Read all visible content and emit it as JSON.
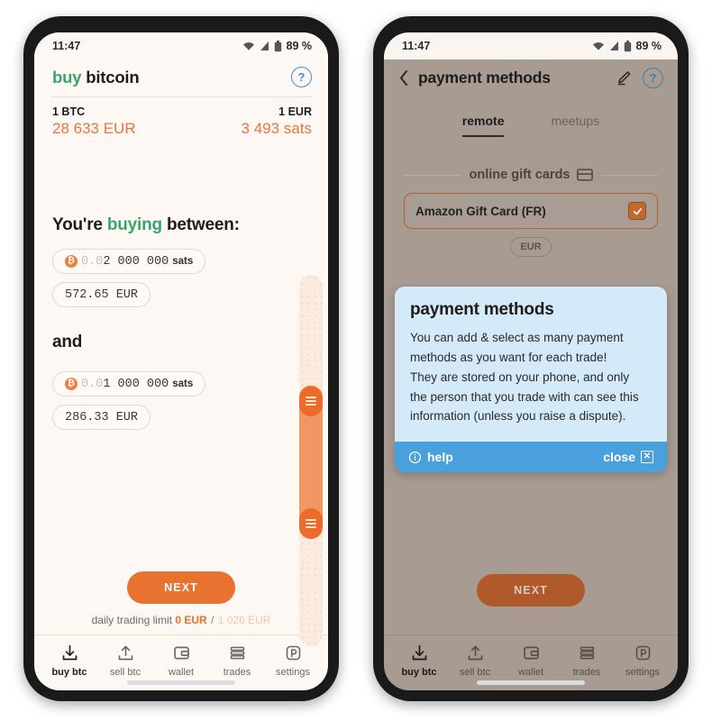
{
  "status_bar": {
    "time": "11:47",
    "battery": "89 %"
  },
  "left": {
    "header": {
      "title_accent": "buy",
      "title_rest": " bitcoin",
      "help_icon": "help-circle-icon"
    },
    "rates": {
      "left_label": "1 BTC",
      "left_value": "28 633 EUR",
      "right_label": "1 EUR",
      "right_value": "3 493 sats"
    },
    "section_one": {
      "prefix": "You're ",
      "accent": "buying",
      "suffix": " between:"
    },
    "section_two": {
      "label": "and"
    },
    "amount_max": {
      "btc_badge": "bitcoin-icon",
      "dim_prefix": "0.0",
      "value": "2 000 000",
      "unit": "sats",
      "fiat": "572.65 EUR"
    },
    "amount_min": {
      "btc_badge": "bitcoin-icon",
      "dim_prefix": "0.0",
      "value": "1 000 000",
      "unit": "sats",
      "fiat": "286.33 EUR"
    },
    "slider": {
      "name": "range-slider",
      "thumb_top_pct": 34,
      "thumb_bottom_pct": 67
    },
    "next_label": "NEXT",
    "limit": {
      "label": "daily trading limit",
      "used": "0 EUR",
      "slash": "/",
      "max": "1 026 EUR"
    }
  },
  "right": {
    "header": {
      "back_icon": "chevron-left-icon",
      "title": "payment methods",
      "edit_icon": "pencil-icon",
      "help_icon": "help-circle-icon"
    },
    "tabs": [
      {
        "label": "remote",
        "active": true
      },
      {
        "label": "meetups",
        "active": false
      }
    ],
    "section": {
      "title": "online gift cards",
      "icon": "card-icon"
    },
    "payment_method": {
      "label": "Amazon Gift Card (FR)",
      "checked": true
    },
    "currency_chip": "EUR",
    "next_label": "NEXT",
    "modal": {
      "title": "payment methods",
      "lines": [
        "You can add & select as many payment",
        "methods as you want for each trade!",
        "They are stored on your phone, and only",
        "the person that you trade with can see this",
        "information (unless you raise a dispute)."
      ],
      "help_label": "help",
      "close_label": "close"
    }
  },
  "nav": [
    {
      "label": "buy btc",
      "icon": "download-tray-icon",
      "active": true
    },
    {
      "label": "sell btc",
      "icon": "upload-tray-icon",
      "active": false
    },
    {
      "label": "wallet",
      "icon": "wallet-icon",
      "active": false
    },
    {
      "label": "trades",
      "icon": "stacked-bars-icon",
      "active": false
    },
    {
      "label": "settings",
      "icon": "peach-p-icon",
      "active": false
    }
  ],
  "colors": {
    "accent_orange": "#e8722f",
    "accent_green": "#36a76c",
    "info_blue": "#49a0dd",
    "modal_bg": "#d4eaf8",
    "screen_bg": "#fdf8f4",
    "dim_overlay": "#a79b92"
  }
}
